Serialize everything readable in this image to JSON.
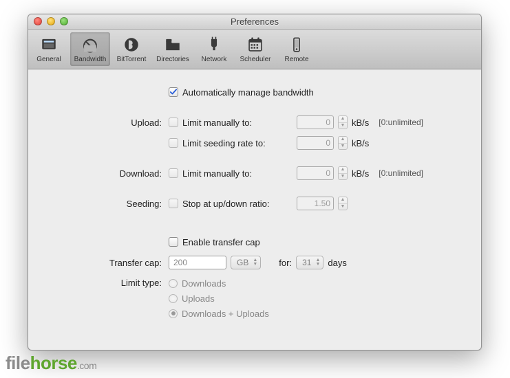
{
  "window": {
    "title": "Preferences"
  },
  "tabs": [
    {
      "key": "general",
      "label": "General"
    },
    {
      "key": "bandwidth",
      "label": "Bandwidth"
    },
    {
      "key": "bittorrent",
      "label": "BitTorrent"
    },
    {
      "key": "directories",
      "label": "Directories"
    },
    {
      "key": "network",
      "label": "Network"
    },
    {
      "key": "scheduler",
      "label": "Scheduler"
    },
    {
      "key": "remote",
      "label": "Remote"
    }
  ],
  "auto_manage": {
    "label": "Automatically manage bandwidth",
    "checked": true
  },
  "sections": {
    "upload": {
      "title": "Upload:"
    },
    "download": {
      "title": "Download:"
    },
    "seeding": {
      "title": "Seeding:"
    },
    "transfer_cap": {
      "title": "Transfer cap:"
    },
    "limit_type": {
      "title": "Limit type:"
    }
  },
  "upload_limit": {
    "label": "Limit manually to:",
    "value": "0",
    "unit": "kB/s",
    "hint": "[0:unlimited]"
  },
  "upload_seed": {
    "label": "Limit seeding rate to:",
    "value": "0",
    "unit": "kB/s"
  },
  "download_limit": {
    "label": "Limit manually to:",
    "value": "0",
    "unit": "kB/s",
    "hint": "[0:unlimited]"
  },
  "seeding_stop": {
    "label": "Stop at up/down ratio:",
    "value": "1.50"
  },
  "enable_cap": {
    "label": "Enable transfer cap",
    "checked": false
  },
  "cap": {
    "value": "200",
    "unit_select": "GB",
    "for_label": "for:",
    "days_select": "31",
    "days_label": "days"
  },
  "limit_type": {
    "downloads": "Downloads",
    "uploads": "Uploads",
    "both": "Downloads + Uploads",
    "selected": "both"
  },
  "watermark": {
    "p1": "file",
    "p2": "horse",
    "tld": ".com"
  }
}
